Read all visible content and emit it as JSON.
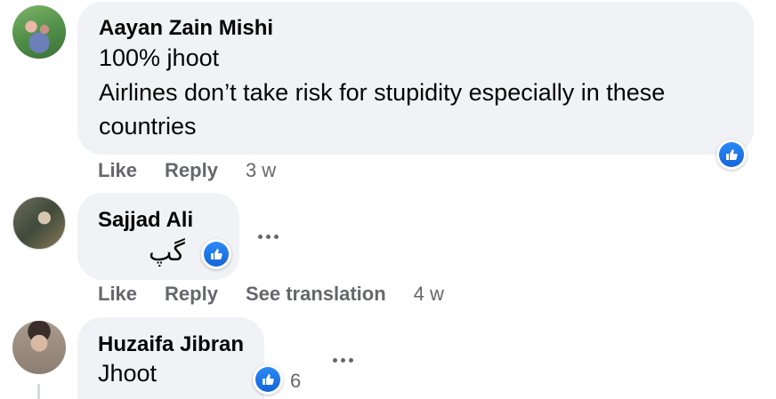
{
  "comments": [
    {
      "author": "Aayan Zain Mishi",
      "lines": [
        "100% jhoot",
        "Airlines don’t take risk for stupidity especially in these",
        "countries"
      ],
      "actions": {
        "like": "Like",
        "reply": "Reply",
        "time": "3 w"
      }
    },
    {
      "author": "Sajjad Ali",
      "text": "گپ",
      "actions": {
        "like": "Like",
        "reply": "Reply",
        "translate": "See translation",
        "time": "4 w"
      }
    },
    {
      "author": "Huzaifa Jibran",
      "text": "Jhoot",
      "reaction_count": "6"
    }
  ],
  "colors": {
    "bubble": "#f0f2f5",
    "like_blue": "#1877f2",
    "meta_gray": "#65676b"
  },
  "icons": {
    "reaction": "thumbs-up-icon",
    "more": "more-dots-icon"
  }
}
